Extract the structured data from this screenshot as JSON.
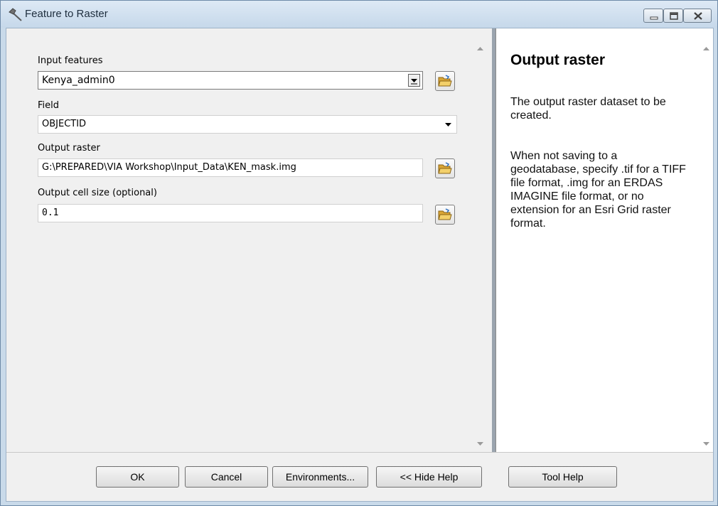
{
  "window": {
    "title": "Feature to Raster"
  },
  "form": {
    "input_features": {
      "label": "Input features",
      "value": "Kenya_admin0"
    },
    "field": {
      "label": "Field",
      "value": "OBJECTID"
    },
    "output_raster": {
      "label": "Output raster",
      "value": "G:\\PREPARED\\VIA Workshop\\Input_Data\\KEN_mask.img"
    },
    "cell_size": {
      "label": "Output cell size (optional)",
      "value": "0.1"
    }
  },
  "help": {
    "title": "Output raster",
    "paragraphs": [
      "The output raster dataset to be created.",
      "When not saving to a geodatabase, specify .tif for a TIFF file format, .img for an ERDAS IMAGINE file format, or no extension for an Esri Grid raster format."
    ]
  },
  "buttons": {
    "ok": "OK",
    "cancel": "Cancel",
    "environments": "Environments...",
    "hide_help": "<< Hide Help",
    "tool_help": "Tool Help"
  },
  "icons": {
    "title": "hammer-icon",
    "browse": "folder-open-icon"
  }
}
